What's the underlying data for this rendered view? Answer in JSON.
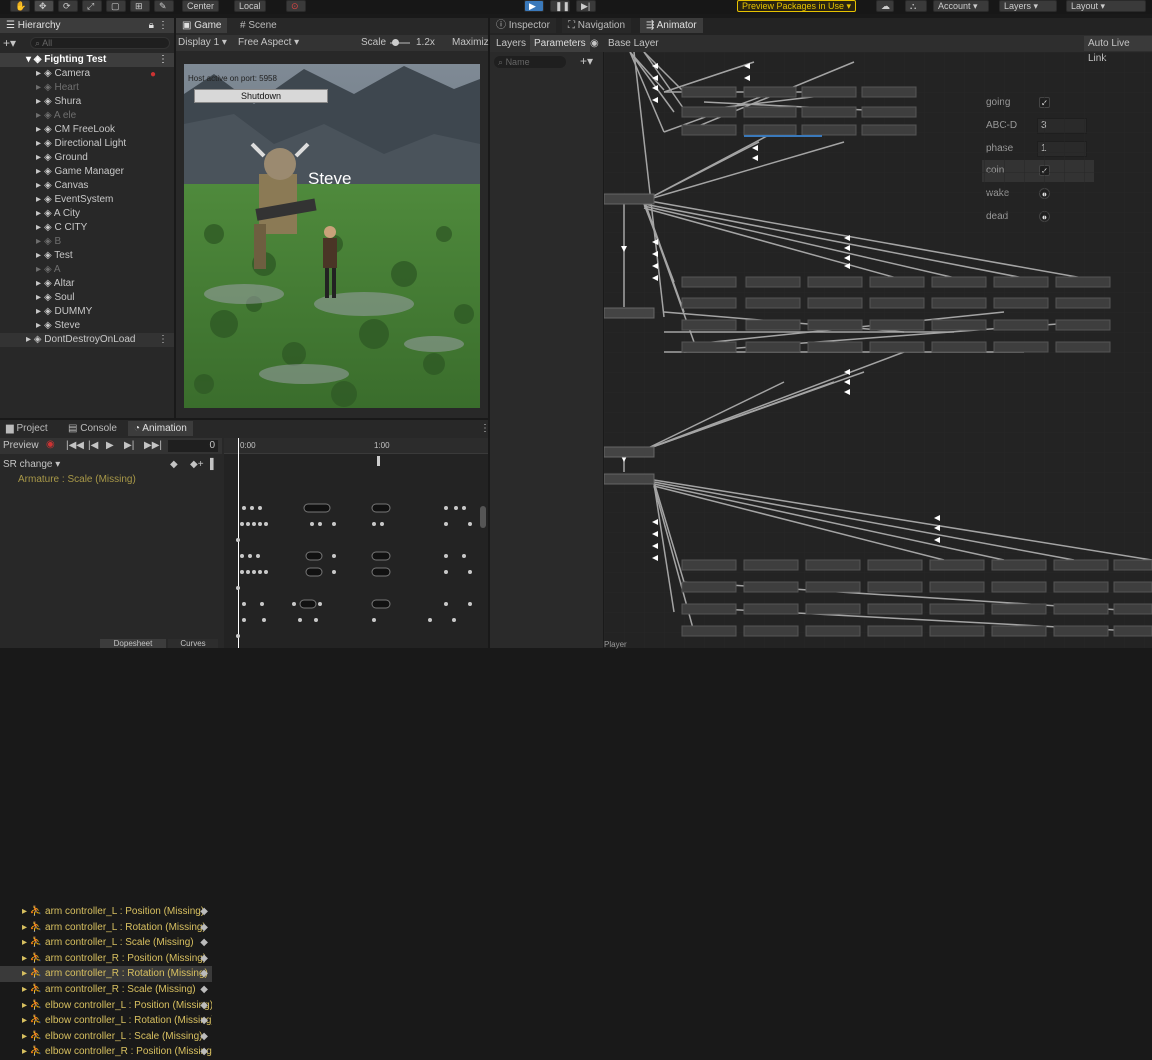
{
  "toolbar": {
    "pivot_label": "Center",
    "space_label": "Local",
    "preview_packages_label": "Preview Packages in Use",
    "account_label": "Account",
    "layers_label": "Layers",
    "layout_label": "Layout"
  },
  "hierarchy": {
    "tab_label": "Hierarchy",
    "search_placeholder": "All",
    "scene_name": "Fighting Test",
    "items": [
      {
        "label": "Camera",
        "dim": false
      },
      {
        "label": "Heart",
        "dim": true
      },
      {
        "label": "Shura",
        "dim": false
      },
      {
        "label": "A ele",
        "dim": true
      },
      {
        "label": "CM FreeLook",
        "dim": false
      },
      {
        "label": "Directional Light",
        "dim": false
      },
      {
        "label": "Ground",
        "dim": false
      },
      {
        "label": "Game Manager",
        "dim": false
      },
      {
        "label": "Canvas",
        "dim": false
      },
      {
        "label": "EventSystem",
        "dim": false
      },
      {
        "label": "A City",
        "dim": false
      },
      {
        "label": "C CITY",
        "dim": false
      },
      {
        "label": "B",
        "dim": true
      },
      {
        "label": "Test",
        "dim": false
      },
      {
        "label": "A",
        "dim": true
      },
      {
        "label": "Altar",
        "dim": false
      },
      {
        "label": "Soul",
        "dim": false
      },
      {
        "label": "DUMMY",
        "dim": false
      },
      {
        "label": "Steve",
        "dim": false
      }
    ],
    "dont_destroy": "DontDestroyOnLoad"
  },
  "game": {
    "tab_game": "Game",
    "tab_scene": "Scene",
    "display": "Display 1",
    "aspect": "Free Aspect",
    "scale_label": "Scale",
    "scale_value": "1.2x",
    "maximize_label": "Maximiz",
    "host_text": "Host active on port: 5958",
    "shutdown_label": "Shutdown",
    "player_name": "Steve"
  },
  "bottom": {
    "tab_project": "Project",
    "tab_console": "Console",
    "tab_animation": "Animation",
    "preview_label": "Preview",
    "frame_value": "0",
    "clip_name": "SR change",
    "time_start": "0:00",
    "time_mid": "1:00",
    "tab_dopesheet": "Dopesheet",
    "tab_curves": "Curves",
    "header_row": "Armature : Scale (Missing)",
    "rows": [
      "arm controller_L : Position (Missing)",
      "arm controller_L : Rotation (Missing)",
      "arm controller_L : Scale (Missing)",
      "arm controller_R : Position (Missing)",
      "arm controller_R : Rotation (Missing)",
      "arm controller_R : Scale (Missing)",
      "elbow controller_L : Position (Missing)",
      "elbow controller_L : Rotation (Missing)",
      "elbow controller_L : Scale (Missing)",
      "elbow controller_R : Position (Missing)"
    ]
  },
  "inspector": {
    "tab_inspector": "Inspector",
    "tab_navigation": "Navigation",
    "tab_animator": "Animator",
    "tab_layers": "Layers",
    "tab_parameters": "Parameters",
    "base_layer": "Base Layer",
    "auto_live_link": "Auto Live Link",
    "search_placeholder": "Name",
    "params": [
      {
        "name": "going",
        "type": "bool",
        "value": "✓"
      },
      {
        "name": "ABC-D",
        "type": "int",
        "value": "3"
      },
      {
        "name": "phase",
        "type": "int",
        "value": "1"
      },
      {
        "name": "coin",
        "type": "bool",
        "value": "✓"
      },
      {
        "name": "wake",
        "type": "trigger",
        "value": "●"
      },
      {
        "name": "dead",
        "type": "trigger",
        "value": "●"
      }
    ],
    "footer_left": "Player"
  },
  "colors": {
    "accent": "#3a79bb",
    "preview_yellow": "#e6c200",
    "missing_yellow": "#d8c060",
    "record_red": "#cc3333"
  }
}
